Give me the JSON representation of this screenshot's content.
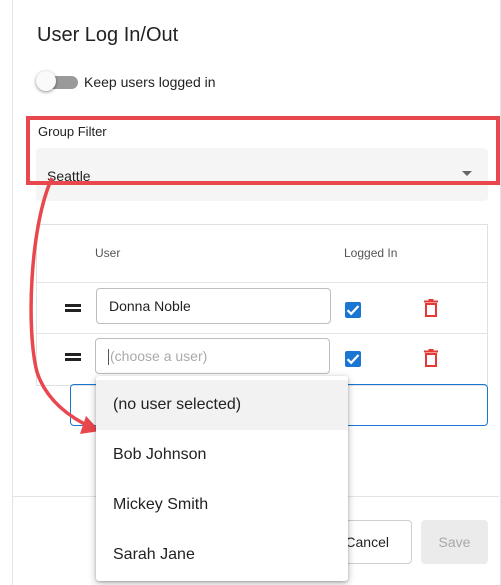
{
  "dialog": {
    "title": "User Log In/Out",
    "keep_logged_in": {
      "label": "Keep users logged in",
      "checked": false
    },
    "group_filter": {
      "label": "Group Filter",
      "value": "Seattle"
    },
    "table": {
      "headers": {
        "user": "User",
        "logged_in": "Logged In"
      },
      "rows": [
        {
          "user": "Donna Noble",
          "logged_in": true
        },
        {
          "user": "",
          "placeholder": "(choose a user)",
          "logged_in": true
        }
      ]
    },
    "user_dropdown": {
      "options": [
        "(no user selected)",
        "Bob Johnson",
        "Mickey Smith",
        "Sarah Jane"
      ],
      "highlighted_index": 0
    },
    "buttons": {
      "cancel": "Cancel",
      "save": "Save"
    }
  },
  "colors": {
    "annotation_red": "#e8474e",
    "accent_blue": "#1976d2",
    "delete_red": "#e53935"
  },
  "icons": [
    "drag-handle-icon",
    "checkbox-checked-icon",
    "trash-icon",
    "dropdown-caret-icon"
  ]
}
